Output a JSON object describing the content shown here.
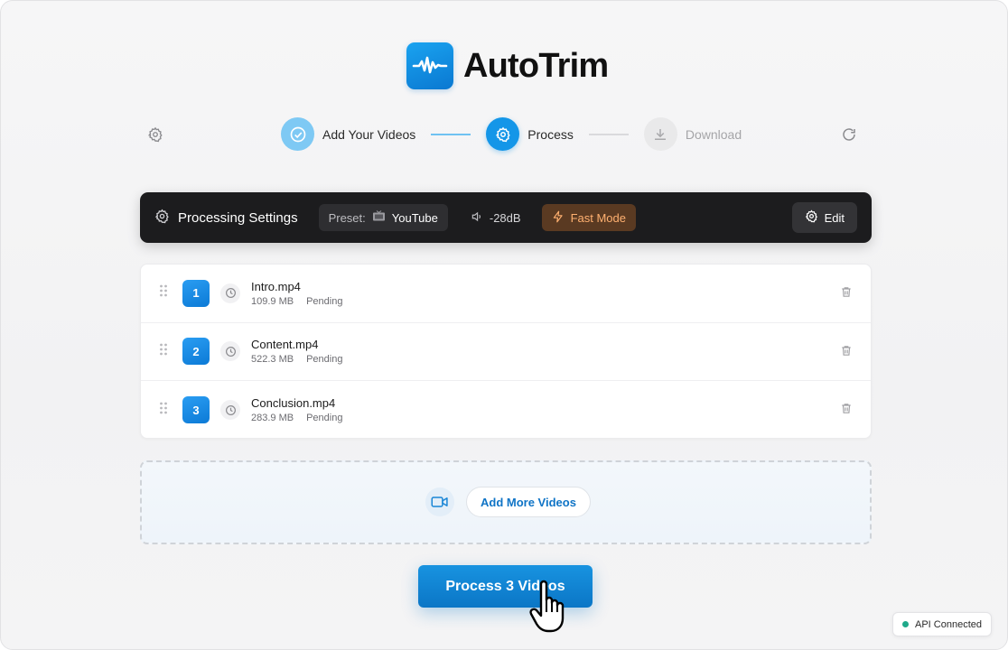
{
  "app": {
    "name": "AutoTrim"
  },
  "stepper": {
    "steps": [
      {
        "label": "Add Your Videos",
        "state": "done",
        "icon": "check-circle-icon"
      },
      {
        "label": "Process",
        "state": "active",
        "icon": "gear-icon"
      },
      {
        "label": "Download",
        "state": "todo",
        "icon": "download-icon"
      }
    ]
  },
  "toolbar": {
    "settings_icon": "gear-icon",
    "reset_icon": "refresh-icon"
  },
  "settings_bar": {
    "title": "Processing Settings",
    "preset_label": "Preset:",
    "preset_value": "YouTube",
    "threshold": "-28dB",
    "mode": "Fast Mode",
    "edit_label": "Edit"
  },
  "files": [
    {
      "index": "1",
      "name": "Intro.mp4",
      "size": "109.9 MB",
      "status": "Pending"
    },
    {
      "index": "2",
      "name": "Content.mp4",
      "size": "522.3 MB",
      "status": "Pending"
    },
    {
      "index": "3",
      "name": "Conclusion.mp4",
      "size": "283.9 MB",
      "status": "Pending"
    }
  ],
  "drop_zone": {
    "button_label": "Add More Videos"
  },
  "actions": {
    "process_label": "Process 3 Videos"
  },
  "status": {
    "api": "API Connected"
  },
  "colors": {
    "accent": "#1496e8",
    "fast_mode": "#ffb070",
    "api_ok": "#1fa98a"
  }
}
